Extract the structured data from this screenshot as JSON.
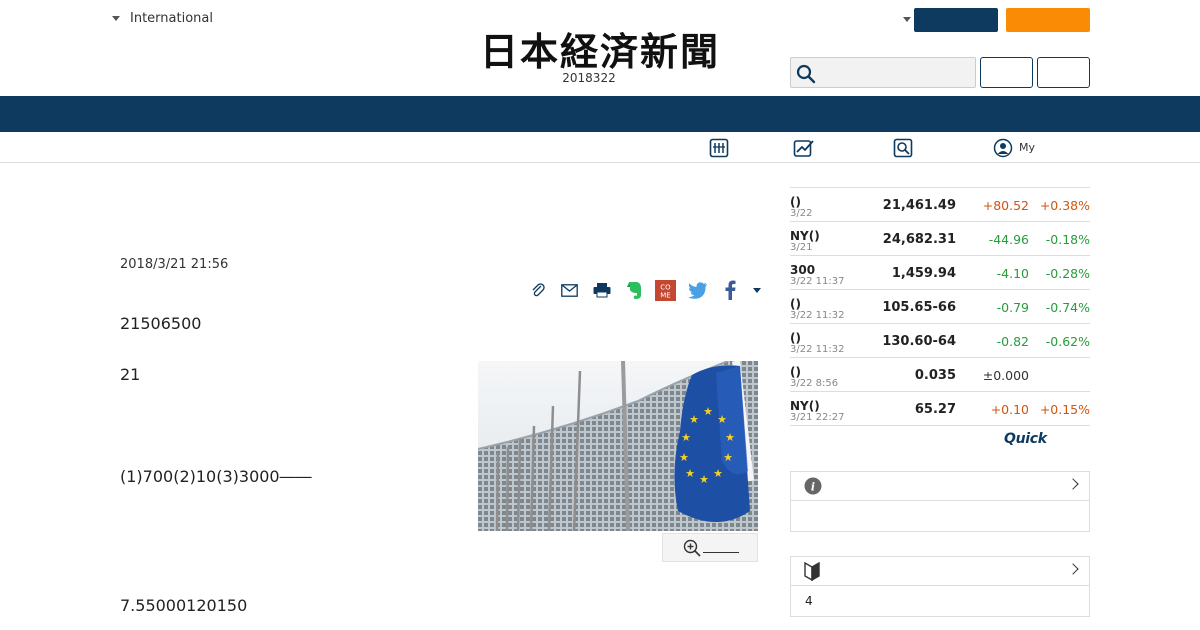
{
  "header": {
    "edition_label": "International",
    "logo_text": "日本経済新聞",
    "date": "2018322",
    "brand_navy": "#0d3a5e",
    "brand_orange": "#f98b05"
  },
  "subnav": {
    "items": [
      {
        "icon": "market-board-icon",
        "label": ""
      },
      {
        "icon": "chart-icon",
        "label": ""
      },
      {
        "icon": "search-news-icon",
        "label": ""
      },
      {
        "icon": "user-icon",
        "label": "My"
      }
    ]
  },
  "article": {
    "date": "2018/3/21 21:56",
    "paragraphs": [
      "21506500",
      "21",
      "(1)700(2)10(3)3000――",
      "7.55000120150"
    ],
    "share_icons": [
      "clip-icon",
      "mail-icon",
      "print-icon",
      "evernote-icon",
      "comment-icon",
      "twitter-icon",
      "facebook-icon",
      "more-icon"
    ]
  },
  "market": {
    "rows": [
      {
        "name": "()",
        "time": "3/22",
        "value": "21,461.49",
        "change": "+80.52",
        "pct": "+0.38%",
        "dir": "up"
      },
      {
        "name": "NY()",
        "time": "3/21",
        "value": "24,682.31",
        "change": "-44.96",
        "pct": "-0.18%",
        "dir": "down"
      },
      {
        "name": "300",
        "time": "3/22 11:37",
        "value": "1,459.94",
        "change": "-4.10",
        "pct": "-0.28%",
        "dir": "down"
      },
      {
        "name": "()",
        "time": "3/22 11:32",
        "value": "105.65-66",
        "change": "-0.79",
        "pct": "-0.74%",
        "dir": "down"
      },
      {
        "name": "()",
        "time": "3/22 11:32",
        "value": "130.60-64",
        "change": "-0.82",
        "pct": "-0.62%",
        "dir": "down"
      },
      {
        "name": "()",
        "time": "3/22 8:56",
        "value": "0.035",
        "change": "±0.000",
        "pct": "",
        "dir": "flat"
      },
      {
        "name": "NY()",
        "time": "3/21 22:27",
        "value": "65.27",
        "change": "+0.10",
        "pct": "+0.15%",
        "dir": "up"
      }
    ],
    "provider": "Quick",
    "up_color": "#d2550e",
    "down_color": "#279c3c"
  },
  "sidebar_boxes": [
    {
      "icon": "info-icon",
      "body": ""
    },
    {
      "icon": "beginner-mark-icon",
      "body": "4"
    }
  ]
}
